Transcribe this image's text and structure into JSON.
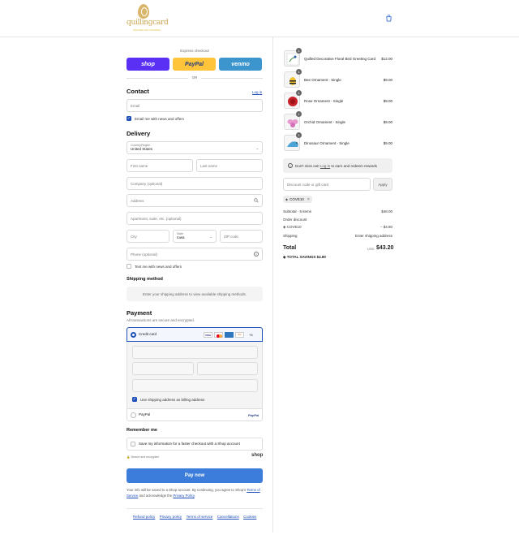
{
  "brand": {
    "name": "quillingcard",
    "tagline": "DESIGNED AND HANDMADE"
  },
  "express": {
    "label": "Express checkout",
    "shop": "shop",
    "paypal": "PayPal",
    "venmo": "venmo",
    "or": "OR"
  },
  "contact": {
    "title": "Contact",
    "login": "Log in",
    "email_placeholder": "Email",
    "news_label": "Email me with news and offers"
  },
  "delivery": {
    "title": "Delivery",
    "country_label": "Country/Region",
    "country_value": "United States",
    "first_name": "First name",
    "last_name": "Last name",
    "company": "Company (optional)",
    "address": "Address",
    "apartment": "Apartment, suite, etc. (optional)",
    "city": "City",
    "state_label": "State",
    "state_value": "Iowa",
    "zip": "ZIP code",
    "phone": "Phone (optional)",
    "text_label": "Text me with news and offers"
  },
  "shipping": {
    "title": "Shipping method",
    "message": "Enter your shipping address to view available shipping methods."
  },
  "payment": {
    "title": "Payment",
    "subtitle": "All transactions are secure and encrypted.",
    "credit_card": "Credit card",
    "more_cards": "+5",
    "billing_label": "Use shipping address as billing address",
    "paypal": "PayPal",
    "paypal_logo": "PayPal"
  },
  "remember": {
    "title": "Remember me",
    "save_label": "Save my information for a faster checkout with a Shop account",
    "secure": "Secure and encrypted",
    "shop_logo": "shop"
  },
  "pay_button": "Pay now",
  "legal": {
    "text1": "Your info will be saved to a Shop account. By continuing, you agree to Shop's",
    "tos": "Terms of Service",
    "and": "and acknowledge the",
    "privacy": "Privacy Policy",
    "period": "."
  },
  "footer": [
    "Refund policy",
    "Privacy policy",
    "Terms of service",
    "Cancellations",
    "Cookies"
  ],
  "cart": {
    "items": [
      {
        "qty": "1",
        "name": "Quilled Decorative Floral Bird Greeting Card",
        "price": "$12.00"
      },
      {
        "qty": "1",
        "name": "Bee Ornament - Single",
        "price": "$9.00"
      },
      {
        "qty": "1",
        "name": "Rose Ornament - Single",
        "price": "$9.00"
      },
      {
        "qty": "1",
        "name": "Orchid Ornament - Single",
        "price": "$9.00"
      },
      {
        "qty": "1",
        "name": "Dinosaur Ornament - Single",
        "price": "$9.00"
      }
    ],
    "rewards": {
      "pre": "Don't miss out!",
      "link": "Log in",
      "post": "to earn and redeem rewards"
    },
    "discount_placeholder": "Discount code or gift card",
    "apply": "Apply",
    "code": "COVE10",
    "subtotal_label": "Subtotal · 5 items",
    "subtotal": "$48.00",
    "order_discount_label": "Order discount",
    "discount_code": "COVE10",
    "discount_amount": "− $4.80",
    "shipping_label": "Shipping",
    "shipping_value": "Enter shipping address",
    "total_label": "Total",
    "currency": "USD",
    "total": "$43.20",
    "savings_label": "TOTAL SAVINGS",
    "savings": "$4.80"
  }
}
